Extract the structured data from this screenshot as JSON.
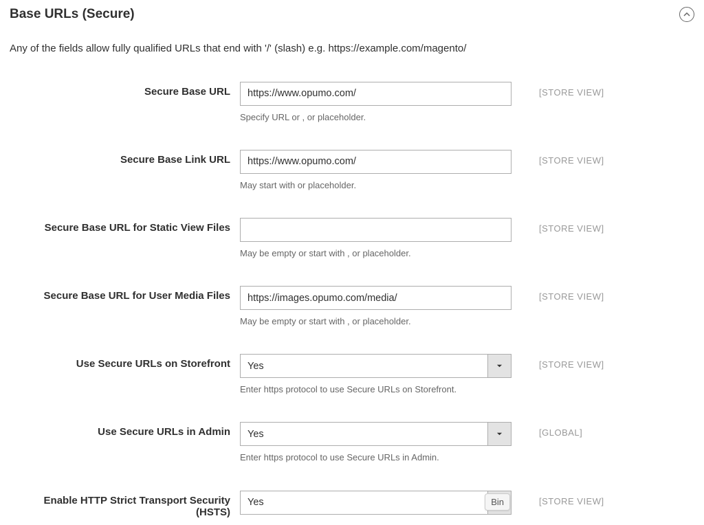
{
  "section": {
    "title": "Base URLs (Secure)",
    "description": "Any of the fields allow fully qualified URLs that end with '/' (slash) e.g. https://example.com/magento/"
  },
  "fields": {
    "base_url": {
      "label": "Secure Base URL",
      "value": "https://www.opumo.com/",
      "note": "Specify URL or , or placeholder.",
      "scope": "[STORE VIEW]"
    },
    "base_link_url": {
      "label": "Secure Base Link URL",
      "value": "https://www.opumo.com/",
      "note": "May start with or placeholder.",
      "scope": "[STORE VIEW]"
    },
    "static_url": {
      "label": "Secure Base URL for Static View Files",
      "value": "",
      "note": "May be empty or start with , or placeholder.",
      "scope": "[STORE VIEW]"
    },
    "media_url": {
      "label": "Secure Base URL for User Media Files",
      "value": "https://images.opumo.com/media/",
      "note": "May be empty or start with , or placeholder.",
      "scope": "[STORE VIEW]"
    },
    "storefront": {
      "label": "Use Secure URLs on Storefront",
      "value": "Yes",
      "note": "Enter https protocol to use Secure URLs on Storefront.",
      "scope": "[STORE VIEW]"
    },
    "admin": {
      "label": "Use Secure URLs in Admin",
      "value": "Yes",
      "note": "Enter https protocol to use Secure URLs in Admin.",
      "scope": "[GLOBAL]"
    },
    "hsts": {
      "label": "Enable HTTP Strict Transport Security (HSTS)",
      "value": "Yes",
      "scope": "[STORE VIEW]",
      "tag": "Bin"
    }
  }
}
